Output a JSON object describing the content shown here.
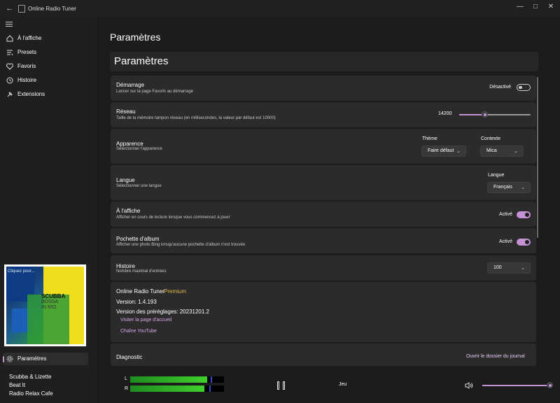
{
  "titlebar": {
    "app_title": "Online Radio Tuner",
    "back_icon": "arrow-left-icon"
  },
  "sidebar": {
    "items": [
      {
        "label": "À l'affiche",
        "icon": "home-icon"
      },
      {
        "label": "Presets",
        "icon": "list-icon"
      },
      {
        "label": "Favoris",
        "icon": "heart-icon"
      },
      {
        "label": "Histoire",
        "icon": "history-icon"
      },
      {
        "label": "Extensions",
        "icon": "puzzle-icon"
      }
    ],
    "settings_label": "Paramètres",
    "album": {
      "hint": "Cliquez pour...",
      "title": "SCUBBA",
      "subtitle_1": "BOSSA",
      "subtitle_2": "IN RIO"
    },
    "recent_songs": [
      "Scubba & Lizette",
      "Beat It",
      "Radio Relax Cafe"
    ]
  },
  "page": {
    "title": "Paramètres",
    "header": "Paramètres"
  },
  "settings": {
    "startup": {
      "title": "Démarrage",
      "desc": "Lancer sur la page Favoris au démarrage",
      "state_label": "Désactivé",
      "on": false
    },
    "network": {
      "title": "Réseau",
      "desc": "Taille de la mémoire tampon réseau (en millisecondes, la valeur par défaut est 10000)",
      "value": "14200",
      "fraction": 0.36
    },
    "appearance": {
      "title": "Apparence",
      "desc": "Sélectionner l'apparence",
      "theme_label": "Thème",
      "theme_value": "Faire défaut",
      "context_label": "Contexte",
      "context_value": "Mica"
    },
    "language": {
      "title": "Langue",
      "desc": "Sélectionner une langue",
      "lang_label": "Langue",
      "lang_value": "Français"
    },
    "now_playing": {
      "title": "À l'affiche",
      "desc": "Afficher en cours de lecture lorsque vous commencez à jouer",
      "state_label": "Activé",
      "on": true
    },
    "cover": {
      "title": "Pochette d'album",
      "desc": "Afficher une photo Bing lorsqu'aucune pochette d'album n'est trouvée",
      "state_label": "Activé",
      "on": true
    },
    "history": {
      "title": "Histoire",
      "desc": "Nombre maximal d'entrées",
      "value": "100"
    },
    "about": {
      "app_name": "Online Radio Tuner",
      "edition": "Premium",
      "version": "Version: 1.4.193",
      "presets_version": "Version des préréglages: 20231201.2",
      "homepage_link": "Visiter la page d'accueil",
      "youtube_link": "Chaîne YouTube"
    },
    "diagnostics": {
      "title": "Diagnostic",
      "open_log": "Ouvrir le dossier du journal"
    }
  },
  "player": {
    "left_label": "L",
    "right_label": "R",
    "left_level": 0.82,
    "right_level": 0.79,
    "status": "Jeu",
    "volume": 0.96,
    "accent": "#c592d6"
  }
}
